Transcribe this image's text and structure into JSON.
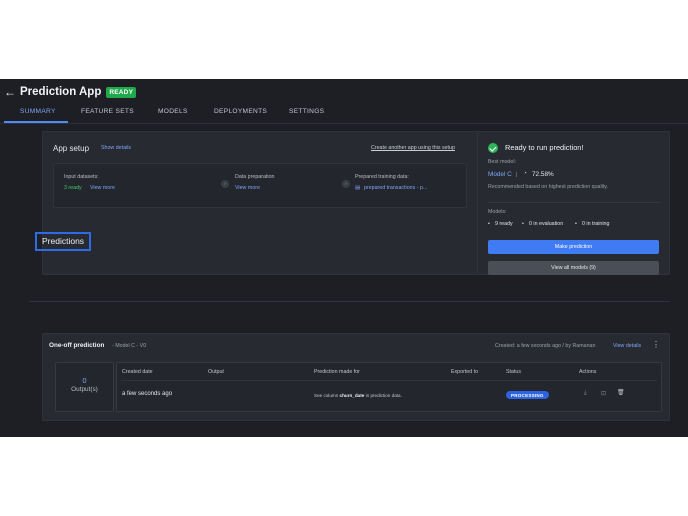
{
  "header": {
    "back": "←",
    "title": "Prediction App",
    "badge": "READY"
  },
  "tabs": [
    {
      "label": "SUMMARY"
    },
    {
      "label": "FEATURE SETS"
    },
    {
      "label": "MODELS"
    },
    {
      "label": "DEPLOYMENTS"
    },
    {
      "label": "SETTINGS"
    }
  ],
  "setup": {
    "title": "App setup",
    "show_details": "Show details",
    "create_link": "Create another app using this setup",
    "input_label": "Input datasets:",
    "input_value": "3 ready",
    "view_more": "View more",
    "prep_label": "Data preparation",
    "prep_link": "View more",
    "train_label": "Prepared training data:",
    "train_value": "prepared transactions - p..."
  },
  "status": {
    "title": "Ready to run prediction!",
    "best_model_label": "Best model:",
    "best_model": "Model C",
    "sep": "|",
    "score": "72.58%",
    "recommendation": "Recommended based on highest prediction quality.",
    "models_label": "Models:",
    "ready": "9 ready",
    "in_eval": "0 in evaluation",
    "in_training": "0 in training",
    "make_prediction": "Make prediction",
    "view_all": "View all models (9)"
  },
  "predictions": {
    "heading": "Predictions",
    "card_title": "One-off prediction",
    "card_model": "- Model C - V0",
    "created": "Created: a few seconds ago / by Ramanan",
    "view_details": "View details",
    "kebab": "⋮",
    "output_count": "0",
    "output_label": "Output(s)",
    "columns": [
      "Created date",
      "Output",
      "Prediction made for",
      "Exported to",
      "Status",
      "Actions"
    ],
    "row": {
      "created": "a few seconds ago",
      "made_for_prefix": "See column",
      "made_for_col": "churn_date",
      "made_for_suffix": "in prediction data.",
      "status": "PROCESSING"
    }
  }
}
